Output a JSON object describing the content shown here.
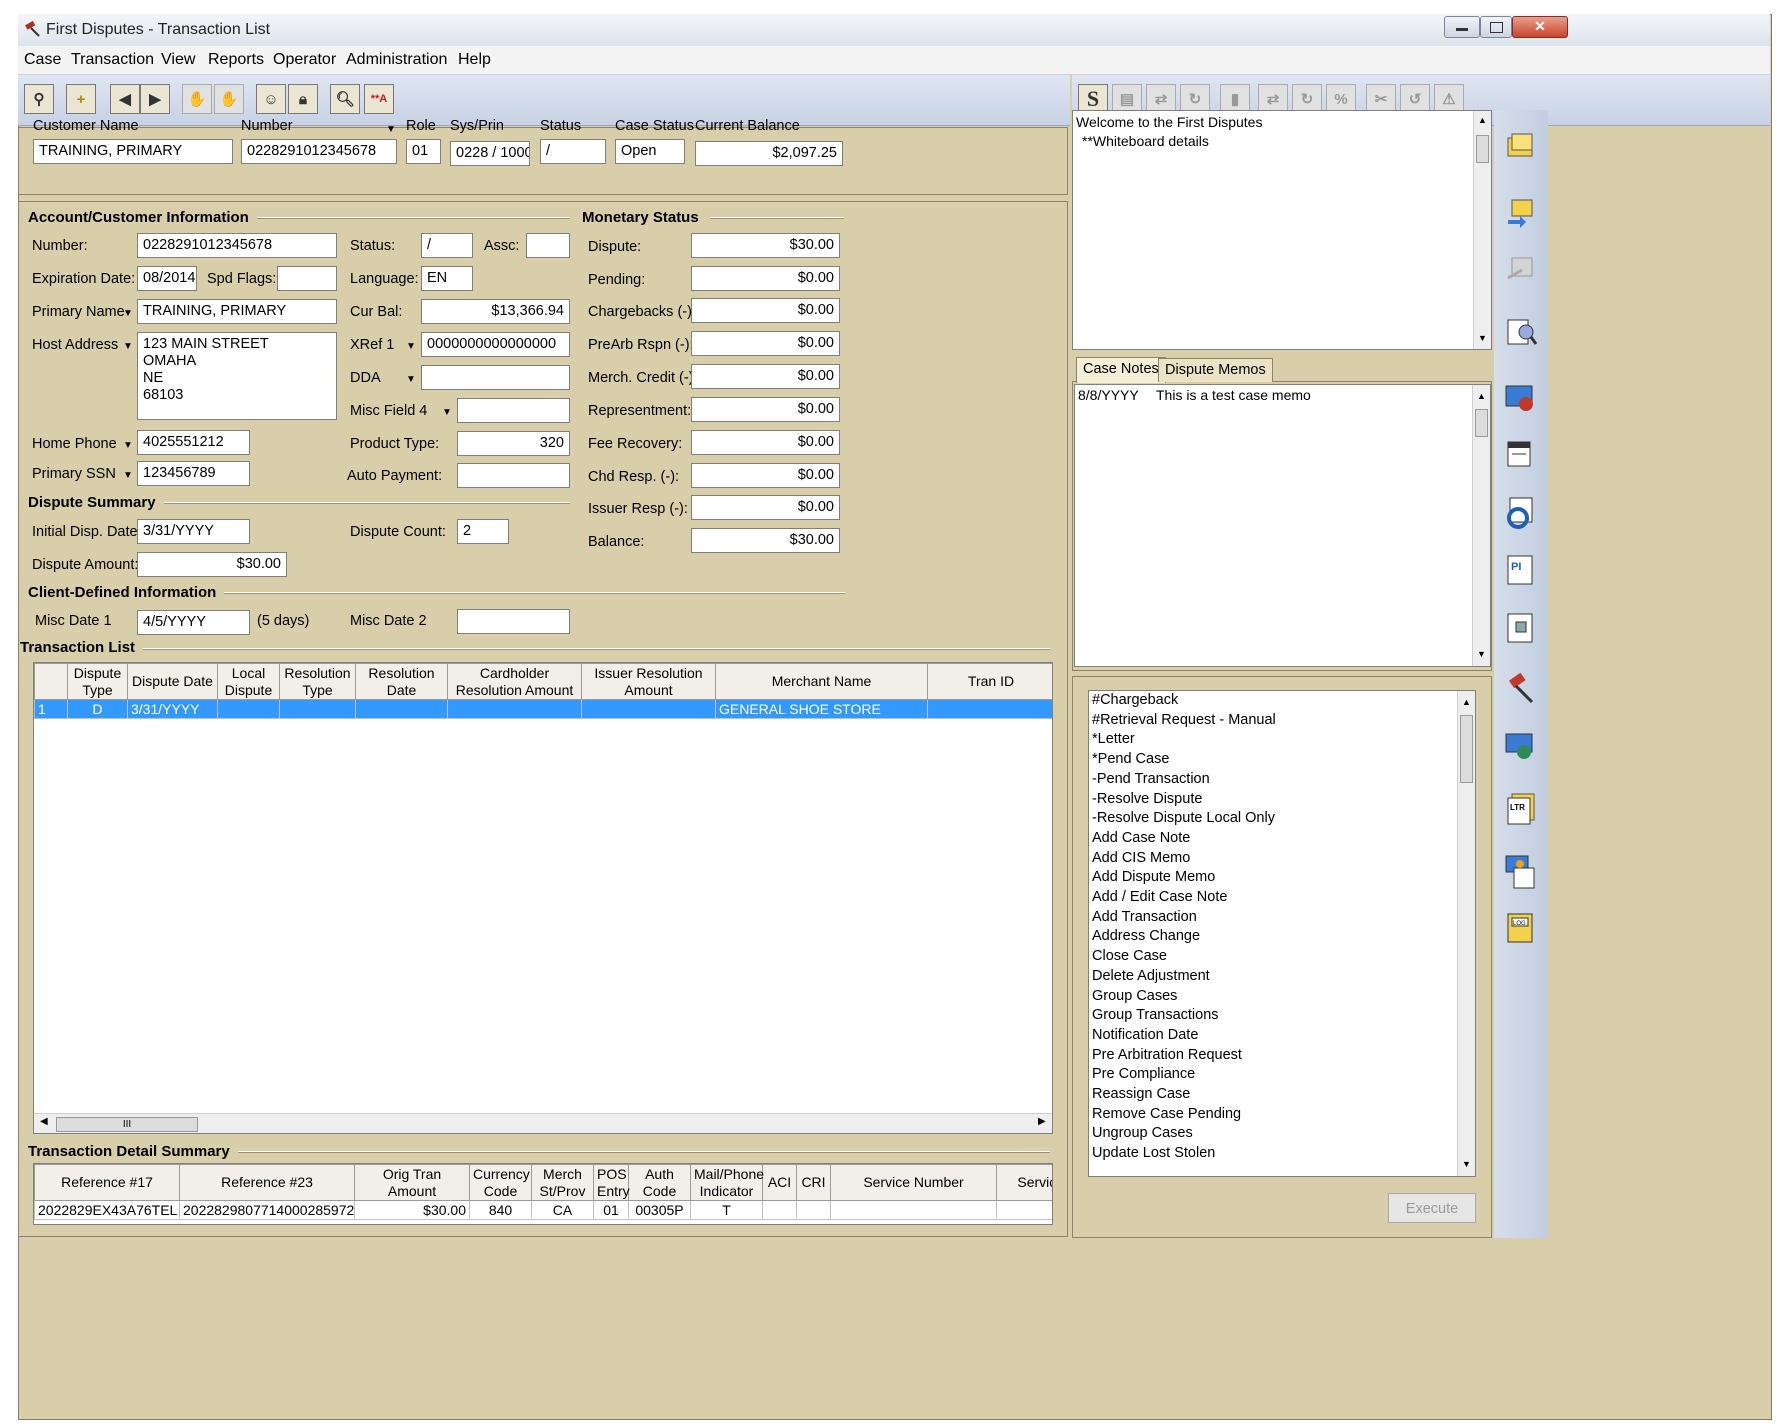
{
  "window": {
    "title": "First Disputes - Transaction List"
  },
  "menu": [
    "Case",
    "Transaction",
    "View",
    "Reports",
    "Operator",
    "Administration",
    "Help"
  ],
  "header": {
    "labels": {
      "customer_name": "Customer Name",
      "number": "Number",
      "role": "Role",
      "sys_prin": "Sys/Prin",
      "status": "Status",
      "case_status": "Case Status",
      "current_balance": "Current Balance"
    },
    "values": {
      "customer_name": "TRAINING, PRIMARY",
      "number": "0228291012345678",
      "role": "01",
      "sys_prin": "0228 / 1000",
      "status": "/",
      "case_status": "Open",
      "current_balance": "$2,097.25"
    }
  },
  "account": {
    "section_title": "Account/Customer Information",
    "labels": {
      "number": "Number:",
      "expiration": "Expiration Date:",
      "spd_flags": "Spd Flags:",
      "primary_name": "Primary Name",
      "host_address": "Host Address",
      "home_phone": "Home Phone",
      "primary_ssn": "Primary SSN",
      "status": "Status:",
      "assc": "Assc:",
      "language": "Language:",
      "cur_bal": "Cur Bal:",
      "xref1": "XRef 1",
      "dda": "DDA",
      "misc_field4": "Misc Field 4",
      "product_type": "Product Type:",
      "auto_payment": "Auto Payment:"
    },
    "values": {
      "number": "0228291012345678",
      "expiration": "08/2014",
      "primary_name": "TRAINING, PRIMARY",
      "address_line1": "123 MAIN STREET",
      "address_line2": "OMAHA",
      "address_line3": "NE",
      "address_line4": "68103",
      "home_phone": "4025551212",
      "primary_ssn": "123456789",
      "status": "/",
      "language": "EN",
      "cur_bal": "$13,366.94",
      "xref1": "0000000000000000",
      "product_type": "320"
    }
  },
  "dispute_summary": {
    "section_title": "Dispute Summary",
    "labels": {
      "initial_date": "Initial Disp. Date:",
      "dispute_count": "Dispute Count:",
      "dispute_amount": "Dispute Amount:"
    },
    "values": {
      "initial_date": "3/31/YYYY",
      "dispute_count": "2",
      "dispute_amount": "$30.00"
    }
  },
  "client_defined": {
    "section_title": "Client-Defined Information",
    "labels": {
      "misc_date1": "Misc Date 1",
      "misc_date2": "Misc Date 2"
    },
    "values": {
      "misc_date1": "4/5/YYYY",
      "days_note": "(5 days)"
    }
  },
  "monetary": {
    "section_title": "Monetary Status",
    "rows": [
      {
        "label": "Dispute:",
        "value": "$30.00"
      },
      {
        "label": "Pending:",
        "value": "$0.00"
      },
      {
        "label": "Chargebacks (-):",
        "value": "$0.00"
      },
      {
        "label": "PreArb Rspn (-):",
        "value": "$0.00"
      },
      {
        "label": "Merch. Credit (-):",
        "value": "$0.00"
      },
      {
        "label": "Representment:",
        "value": "$0.00"
      },
      {
        "label": "Fee Recovery:",
        "value": "$0.00"
      },
      {
        "label": "Chd Resp. (-):",
        "value": "$0.00"
      },
      {
        "label": "Issuer Resp (-):",
        "value": "$0.00"
      },
      {
        "label": "Balance:",
        "value": "$30.00"
      }
    ]
  },
  "transaction_list": {
    "section_title": "Transaction List",
    "columns": [
      "Dispute Type",
      "Dispute Date",
      "Local Dispute",
      "Resolution Type",
      "Resolution Date",
      "Cardholder Resolution Amount",
      "Issuer Resolution Amount",
      "Merchant Name",
      "Tran ID"
    ],
    "rows": [
      {
        "index": "1",
        "cells": [
          "D",
          "3/31/YYYY",
          "",
          "",
          "",
          "",
          "",
          "GENERAL SHOE STORE",
          ""
        ]
      }
    ]
  },
  "detail_summary": {
    "section_title": "Transaction Detail Summary",
    "columns": [
      "Reference #17",
      "Reference #23",
      "Orig Tran Amount",
      "Currency Code",
      "Merch St/Prov",
      "POS Entry",
      "Auth Code",
      "Mail/Phone Indicator",
      "ACI",
      "CRI",
      "Service Number",
      "Servic Code"
    ],
    "rows": [
      [
        "2022829EX43A76TEL",
        "2022829807714000285972",
        "$30.00",
        "840",
        "CA",
        "01",
        "00305P",
        "T",
        "",
        "",
        "",
        ""
      ]
    ]
  },
  "whiteboard": {
    "line1": "Welcome to the  First Disputes",
    "line2": "**Whiteboard details"
  },
  "tabs": [
    "Case Notes",
    "Dispute Memos"
  ],
  "case_notes": [
    {
      "date": "8/8/YYYY",
      "text": "This is a test case memo"
    }
  ],
  "commands": [
    "#Chargeback",
    "#Retrieval Request - Manual",
    "*Letter",
    "*Pend Case",
    "-Pend Transaction",
    "-Resolve Dispute",
    "-Resolve Dispute Local Only",
    "Add Case Note",
    "Add CIS Memo",
    "Add Dispute Memo",
    "Add / Edit Case Note",
    "Add Transaction",
    "Address Change",
    "Close Case",
    "Delete Adjustment",
    "Group Cases",
    "Group Transactions",
    "Notification Date",
    "Pre Arbitration Request",
    "Pre Compliance",
    "Reassign Case",
    "Remove Case Pending",
    "Ungroup Cases",
    "Update Lost Stolen"
  ],
  "execute_label": "Execute",
  "scroll_marker": "III",
  "colors": {
    "selection": "#3399ff",
    "panel": "#d9ceaa",
    "title_icon": "#c0392b"
  }
}
